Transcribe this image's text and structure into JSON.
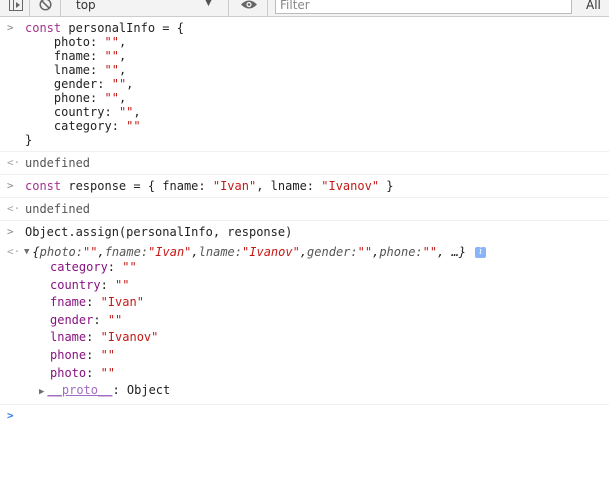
{
  "toolbar": {
    "context_value": "top",
    "filter_placeholder": "Filter",
    "levels_label": "All"
  },
  "icons": {
    "sidebar": "sidebar-toggle-icon",
    "clear": "clear-console-icon",
    "dropdown": "chevron-down-icon",
    "eye": "eye-icon"
  },
  "messages": {
    "m1": {
      "l1": {
        "kw": "const",
        "name": "personalInfo",
        "rest": " = {"
      },
      "props": [
        {
          "key": "photo",
          "val": "\"\""
        },
        {
          "key": "fname",
          "val": "\"\""
        },
        {
          "key": "lname",
          "val": "\"\""
        },
        {
          "key": "gender",
          "val": "\"\""
        },
        {
          "key": "phone",
          "val": "\"\""
        },
        {
          "key": "country",
          "val": "\"\""
        },
        {
          "key": "category",
          "val": "\"\""
        }
      ],
      "close": "}"
    },
    "r1": "undefined",
    "m2": {
      "kw": "const",
      "name": "response",
      "p1": " = { fname: ",
      "v1": "\"Ivan\"",
      "p2": ", lname: ",
      "v2": "\"Ivanov\"",
      "p3": " }"
    },
    "r2": "undefined",
    "m3": {
      "text": "Object.assign(personalInfo, response)"
    },
    "result": {
      "head": [
        {
          "t": "{",
          "k": false
        },
        {
          "t": "photo: ",
          "k": true
        },
        {
          "t": "\"\"",
          "s": true
        },
        {
          "t": ", ",
          "k": false
        },
        {
          "t": "fname: ",
          "k": true
        },
        {
          "t": "\"Ivan\"",
          "s": true
        },
        {
          "t": ", ",
          "k": false
        },
        {
          "t": "lname: ",
          "k": true
        },
        {
          "t": "\"Ivanov\"",
          "s": true
        },
        {
          "t": ", ",
          "k": false
        },
        {
          "t": "gender: ",
          "k": true
        },
        {
          "t": "\"\"",
          "s": true
        },
        {
          "t": ", ",
          "k": false
        },
        {
          "t": "phone: ",
          "k": true
        },
        {
          "t": "\"\"",
          "s": true
        },
        {
          "t": ", …}",
          "k": false
        }
      ],
      "info": "i",
      "props": [
        {
          "key": "category",
          "val": "\"\""
        },
        {
          "key": "country",
          "val": "\"\""
        },
        {
          "key": "fname",
          "val": "\"Ivan\""
        },
        {
          "key": "gender",
          "val": "\"\""
        },
        {
          "key": "lname",
          "val": "\"Ivanov\""
        },
        {
          "key": "phone",
          "val": "\"\""
        },
        {
          "key": "photo",
          "val": "\"\""
        }
      ],
      "proto_key": "__proto__",
      "proto_val": "Object"
    }
  }
}
